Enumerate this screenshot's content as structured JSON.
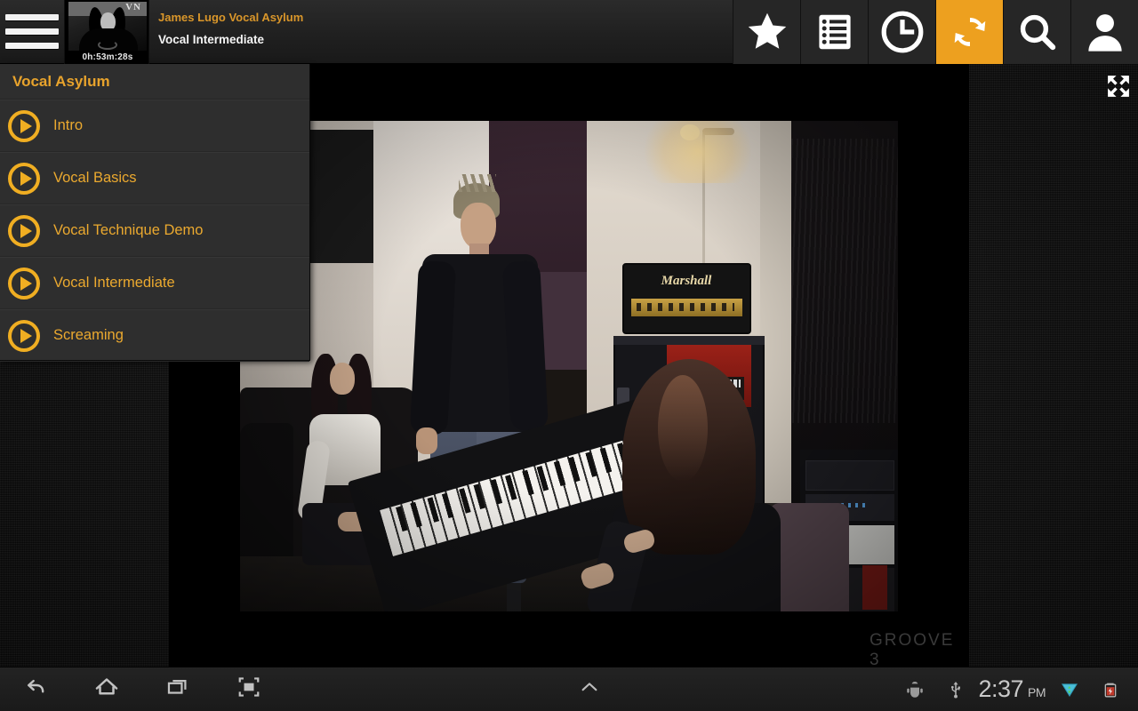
{
  "appbar": {
    "menu_icon": "hamburger-menu-icon",
    "thumbnail": {
      "duration": "0h:53m:28s",
      "backdrop_text": "VN"
    },
    "course_title": "James Lugo Vocal Asylum",
    "lesson_title": "Vocal Intermediate",
    "accent_color": "#d9962a",
    "icons": [
      {
        "name": "favorites-star-icon",
        "label": "Favorites",
        "active": false
      },
      {
        "name": "playlist-notebook-icon",
        "label": "Playlist",
        "active": false
      },
      {
        "name": "history-clock-icon",
        "label": "History",
        "active": false
      },
      {
        "name": "sync-refresh-icon",
        "label": "Sync",
        "active": true
      },
      {
        "name": "search-icon",
        "label": "Search",
        "active": false
      },
      {
        "name": "account-user-icon",
        "label": "Account",
        "active": false
      }
    ],
    "active_icon_color": "#eda01f"
  },
  "drawer": {
    "title": "Vocal Asylum",
    "title_color": "#e8a32c",
    "chapters": [
      {
        "label": "Intro"
      },
      {
        "label": "Vocal Basics"
      },
      {
        "label": "Vocal Technique Demo"
      },
      {
        "label": "Vocal Intermediate"
      },
      {
        "label": "Screaming"
      }
    ]
  },
  "player": {
    "watermark": "GROOVE 3",
    "fullscreen_icon": "fullscreen-expand-icon",
    "scene_description": "Recording studio video still"
  },
  "navbar": {
    "buttons": [
      {
        "name": "back-button",
        "icon": "back-arrow-icon"
      },
      {
        "name": "home-button",
        "icon": "home-icon"
      },
      {
        "name": "recents-button",
        "icon": "recent-apps-icon"
      },
      {
        "name": "screenshot-button",
        "icon": "screenshot-frame-icon"
      },
      {
        "name": "expand-notifications-button",
        "icon": "chevron-up-icon"
      }
    ],
    "tray": {
      "debug_icon": "android-debug-icon",
      "usb_icon": "usb-icon",
      "time": "2:37",
      "period": "PM",
      "signal_icon": "wifi-signal-icon",
      "battery_icon": "battery-charging-icon"
    }
  }
}
